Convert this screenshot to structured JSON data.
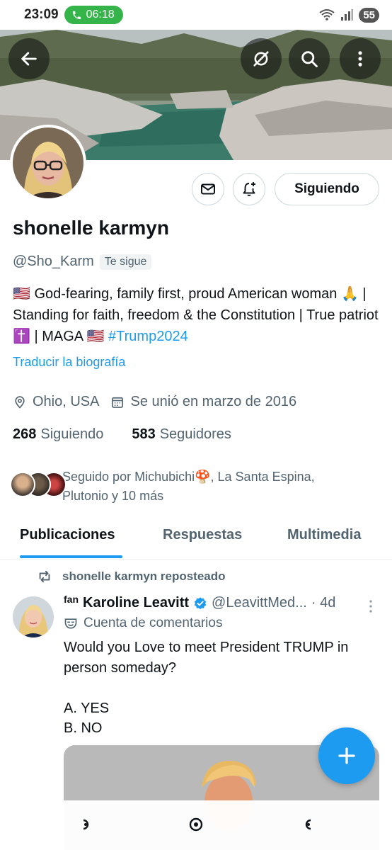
{
  "status_bar": {
    "time": "23:09",
    "call_timer": "06:18",
    "battery": "55"
  },
  "profile": {
    "name": "shonelle karmyn",
    "handle": "@Sho_Karm",
    "follows_you_badge": "Te sigue",
    "bio_text": "🇺🇸 God-fearing, family first, proud American woman 🙏 | Standing for faith, freedom & the Constitution | True patriot ✝️ | MAGA 🇺🇸 ",
    "bio_hashtag": "#Trump2024",
    "translate_bio": "Traducir la biografía",
    "location": "Ohio, USA",
    "joined": "Se unió en marzo de 2016",
    "following_count": "268",
    "following_label": "Siguiendo",
    "followers_count": "583",
    "followers_label": "Seguidores",
    "followed_by": "Seguido por Michubichi🍄, La Santa Espina, Plutonio y 10 más"
  },
  "actions": {
    "follow_state_label": "Siguiendo"
  },
  "tabs": [
    {
      "label": "Publicaciones",
      "active": true
    },
    {
      "label": "Respuestas",
      "active": false
    },
    {
      "label": "Multimedia",
      "active": false
    }
  ],
  "post": {
    "repost_label": "shonelle karmyn reposteado",
    "fan_label": "fan",
    "author": "Karoline Leavitt",
    "handle": "@LeavittMed...",
    "time": "· 4d",
    "account_type": "Cuenta de comentarios",
    "text": "Would you Love to meet President TRUMP in person someday?\n\nA. YES\nB. NO"
  },
  "colors": {
    "accent": "#1d9bf0",
    "secondary_text": "#536471",
    "call_green": "#35b44a"
  }
}
